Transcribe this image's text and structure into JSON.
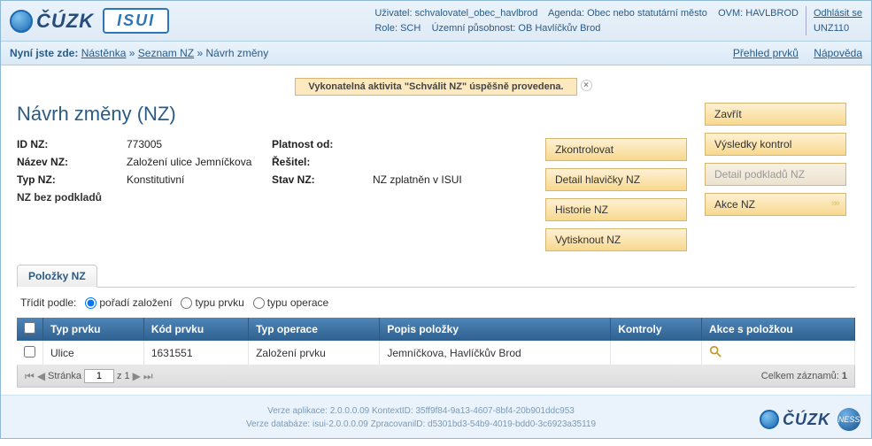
{
  "header": {
    "cuzk_text": "ČÚZK",
    "isui_text": "ISUI",
    "info": {
      "user_label": "Uživatel:",
      "user_value": "schvalovatel_obec_havlbrod",
      "agenda_label": "Agenda:",
      "agenda_value": "Obec nebo statutární město",
      "ovm_label": "OVM:",
      "ovm_value": "HAVLBROD",
      "role_label": "Role:",
      "role_value": "SCH",
      "scope_label": "Územní působnost:",
      "scope_value": "OB Havlíčkův Brod"
    },
    "logout": "Odhlásit se",
    "unz": "UNZ110"
  },
  "breadcrumb": {
    "prefix": "Nyní jste zde:",
    "items": [
      "Nástěnka",
      "Seznam NZ",
      "Návrh změny"
    ],
    "sep": "»",
    "right_links": {
      "overview": "Přehled prvků",
      "help": "Nápověda"
    }
  },
  "alert": {
    "text": "Vykonatelná aktivita \"Schválit NZ\" úspěšně provedena."
  },
  "title": "Návrh změny (NZ)",
  "meta": {
    "id_label": "ID NZ:",
    "id_value": "773005",
    "validity_label": "Platnost od:",
    "validity_value": "",
    "name_label": "Název NZ:",
    "name_value": "Založení ulice Jemníčkova",
    "solver_label": "Řešitel:",
    "solver_value": "",
    "type_label": "Typ NZ:",
    "type_value": "Konstitutivní",
    "state_label": "Stav NZ:",
    "state_value": "NZ zplatněn v ISUI",
    "nobg": "NZ bez podkladů"
  },
  "buttons": {
    "close": "Zavřít",
    "check": "Zkontrolovat",
    "results": "Výsledky kontrol",
    "header_detail": "Detail hlavičky NZ",
    "docs_detail": "Detail podkladů NZ",
    "history": "Historie NZ",
    "actions": "Akce NZ",
    "print": "Vytisknout NZ"
  },
  "tab": {
    "items": "Položky NZ"
  },
  "sort": {
    "label": "Třídit podle:",
    "opt1": "pořadí založení",
    "opt2": "typu prvku",
    "opt3": "typu operace"
  },
  "table": {
    "headers": {
      "type": "Typ prvku",
      "code": "Kód prvku",
      "op": "Typ operace",
      "desc": "Popis položky",
      "checks": "Kontroly",
      "actions": "Akce s položkou"
    },
    "rows": [
      {
        "type": "Ulice",
        "code": "1631551",
        "op": "Založení prvku",
        "desc": "Jemníčkova, Havlíčkův Brod",
        "checks": ""
      }
    ]
  },
  "pager": {
    "page_label": "Stránka",
    "page_value": "1",
    "of_label": "z",
    "total_pages": "1",
    "total_label": "Celkem záznamů:",
    "total_value": "1"
  },
  "footer": {
    "line1": "Verze aplikace: 2.0.0.0.09 KontextID: 35ff9f84-9a13-4607-8bf4-20b901ddc953",
    "line2": "Verze databáze: isui-2.0.0.0.09 ZpracovanilD: d5301bd3-54b9-4019-bdd0-3c6923a35119",
    "cuzk": "ČÚZK",
    "ness": "NESS"
  }
}
